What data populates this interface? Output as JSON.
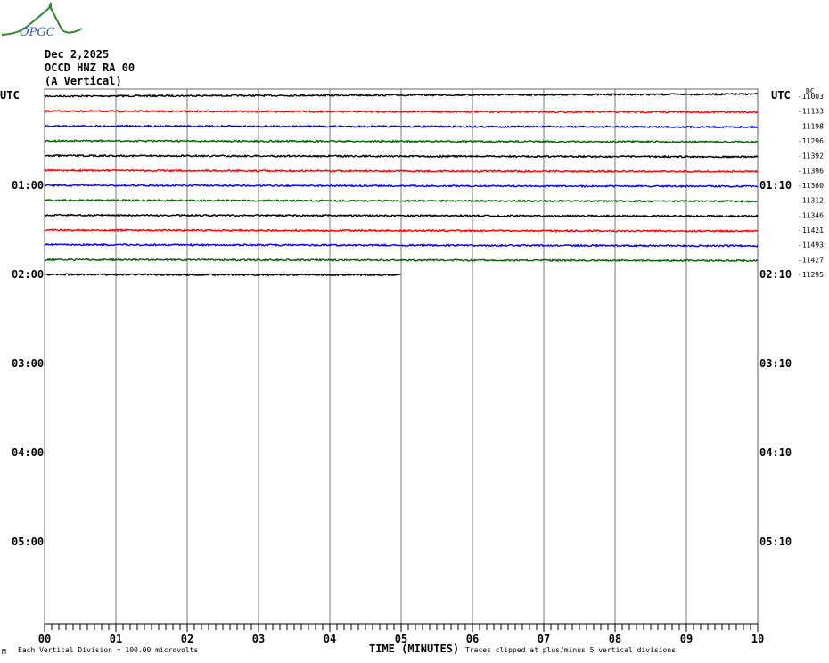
{
  "logo_text": "OPGC",
  "header": {
    "date": "Dec 2,2025",
    "station": "OCCD HNZ RA 00",
    "component": "(A Vertical)"
  },
  "chart_data": {
    "type": "line",
    "title": "Dec 2,2025 OCCD HNZ RA 00 (A Vertical)",
    "xlabel": "TIME (MINUTES)",
    "xlim": [
      0,
      10
    ],
    "x_ticks": [
      "00",
      "01",
      "02",
      "03",
      "04",
      "05",
      "06",
      "07",
      "08",
      "09",
      "10"
    ],
    "left_label": "UTC",
    "right_label": "UTC",
    "dc_label": "DC",
    "left_hour_labels": [
      "01:00",
      "02:00",
      "03:00",
      "04:00",
      "05:00"
    ],
    "right_hour_labels": [
      "01:10",
      "02:10",
      "03:10",
      "04:10",
      "05:10"
    ],
    "rows_per_hour": 6,
    "total_rows": 36,
    "colors": [
      "#000000",
      "#ff0000",
      "#0000ff",
      "#006600"
    ],
    "dc_offsets": [
      -11003,
      -11133,
      -11198,
      -11296,
      -11392,
      -11396,
      -11360,
      -11312,
      -11346,
      -11421,
      -11493,
      -11427,
      -11295
    ],
    "last_row_end_minute": 5,
    "footer_left": "Each Vertical Division =  100.00 microvolts",
    "footer_right": "Traces clipped at plus/minus 5 vertical divisions",
    "corner_mark": "M"
  }
}
